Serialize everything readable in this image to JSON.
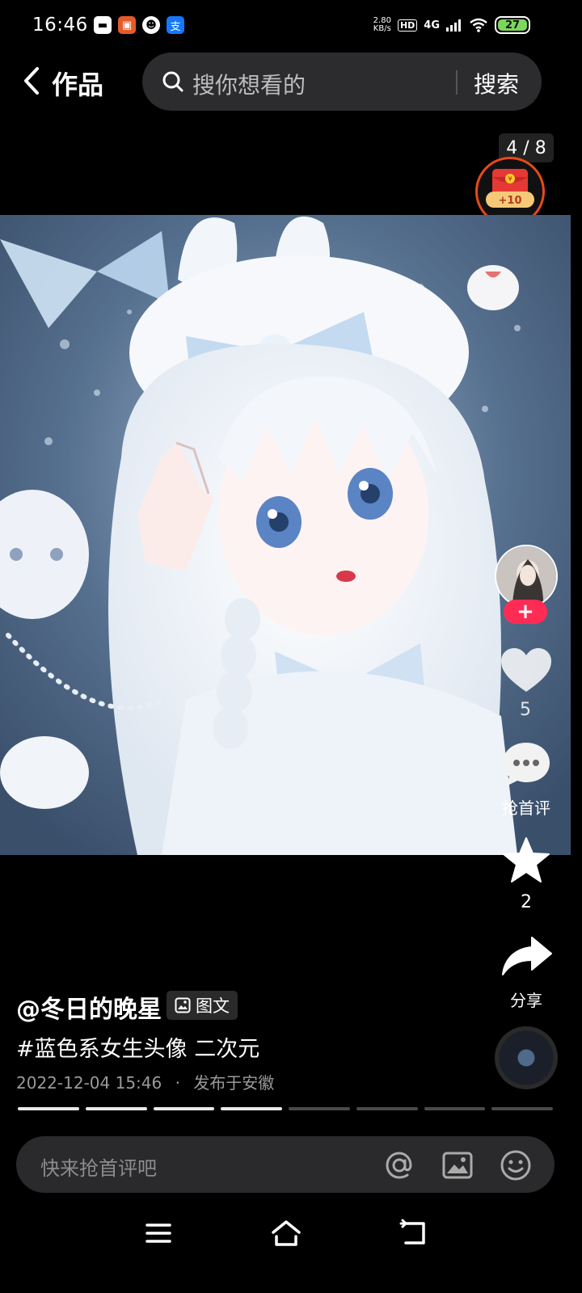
{
  "status_bar": {
    "time": "16:46",
    "net_speed_value": "2.80",
    "net_speed_unit": "KB/s",
    "hd": "HD",
    "network": "4G",
    "battery": "27"
  },
  "header": {
    "title": "作品",
    "search_placeholder": "搜你想看的",
    "search_button": "搜索"
  },
  "page_counter": "4 / 8",
  "redpacket": {
    "bonus": "+10",
    "symbol": "¥"
  },
  "actions": {
    "follow": "+",
    "like_count": "5",
    "comment_label": "抢首评",
    "favorite_count": "2",
    "share_label": "分享"
  },
  "post": {
    "author": "@冬日的晚星",
    "type_badge": "图文",
    "caption": "#蓝色系女生头像 二次元",
    "date": "2022-12-04 15:46",
    "separator": "·",
    "location": "发布于安徽",
    "current_image": 4,
    "total_images": 8
  },
  "comment_bar": {
    "placeholder": "快来抢首评吧"
  },
  "colors": {
    "accent_red": "#fe2c55",
    "redpacket_ring": "#e64a19",
    "background": "#000000"
  },
  "icons": [
    "back-arrow-icon",
    "search-icon",
    "heart-icon",
    "comment-icon",
    "star-icon",
    "share-icon",
    "at-icon",
    "image-icon",
    "emoji-icon",
    "menu-icon",
    "home-icon",
    "back-nav-icon"
  ]
}
